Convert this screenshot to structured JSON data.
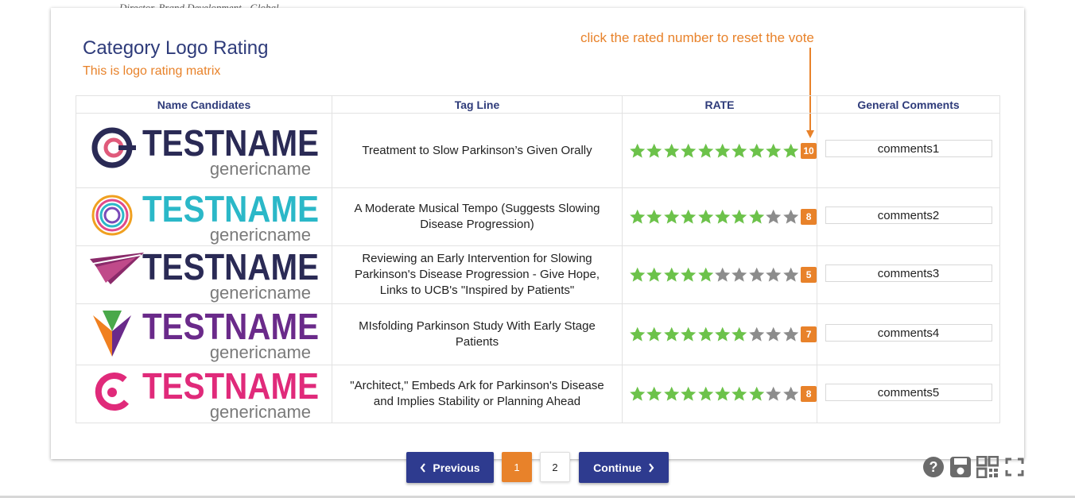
{
  "header": {
    "cut_off_text": "Director, Brand Development - Global",
    "title": "Category Logo Rating",
    "subtitle": "This is logo rating matrix",
    "hint": "click the rated number to reset the vote"
  },
  "table": {
    "columns": [
      "Name Candidates",
      "Tag Line",
      "RATE",
      "General Comments"
    ],
    "max_stars": 10,
    "rows": [
      {
        "logo": {
          "brand": "TESTNAME",
          "generic": "genericname",
          "style": "ring",
          "brand_color": "#2a2a55",
          "accent_color": "#e05a7a"
        },
        "tagline": "Treatment to Slow Parkinson’s Given Orally",
        "rating": 10,
        "rating_label": "10",
        "comment": "comments1"
      },
      {
        "logo": {
          "brand": "TESTNAME",
          "generic": "genericname",
          "style": "swirl",
          "brand_color": "#2bb8c8",
          "accent_color": "#f0a020"
        },
        "tagline": "A Moderate Musical Tempo (Suggests Slowing Disease Progression)",
        "rating": 8,
        "rating_label": "8",
        "comment": "comments2"
      },
      {
        "logo": {
          "brand": "TESTNAME",
          "generic": "genericname",
          "style": "wing",
          "brand_color": "#2a2a55",
          "accent_color": "#8a2a6a"
        },
        "tagline": "Reviewing an Early Intervention for Slowing Parkinson's Disease Progression - Give Hope, Links to UCB's \"Inspired by Patients\"",
        "rating": 5,
        "rating_label": "5",
        "comment": "comments3"
      },
      {
        "logo": {
          "brand": "TESTNAME",
          "generic": "genericname",
          "style": "kite",
          "brand_color": "#6a2a8a",
          "accent_color": "#f08020"
        },
        "tagline": "MIsfolding Parkinson Study With Early Stage Patients",
        "rating": 7,
        "rating_label": "7",
        "comment": "comments4"
      },
      {
        "logo": {
          "brand": "TESTNAME",
          "generic": "genericname",
          "style": "hook",
          "brand_color": "#e02a7a",
          "accent_color": "#e02a7a"
        },
        "tagline": "\"Architect,\" Embeds Ark for Parkinson's Disease and Implies Stability or Planning Ahead",
        "rating": 8,
        "rating_label": "8",
        "comment": "comments5"
      }
    ]
  },
  "pagination": {
    "previous_label": "Previous",
    "continue_label": "Continue",
    "pages": [
      "1",
      "2"
    ],
    "current_page": "1"
  },
  "tools": {
    "icons": [
      "help-icon",
      "save-icon",
      "qr-code-icon",
      "fullscreen-icon"
    ]
  },
  "colors": {
    "star_on": "#6cc24a",
    "star_off": "#8c8c8c",
    "accent": "#e8822a",
    "navy": "#2e3b8f"
  }
}
